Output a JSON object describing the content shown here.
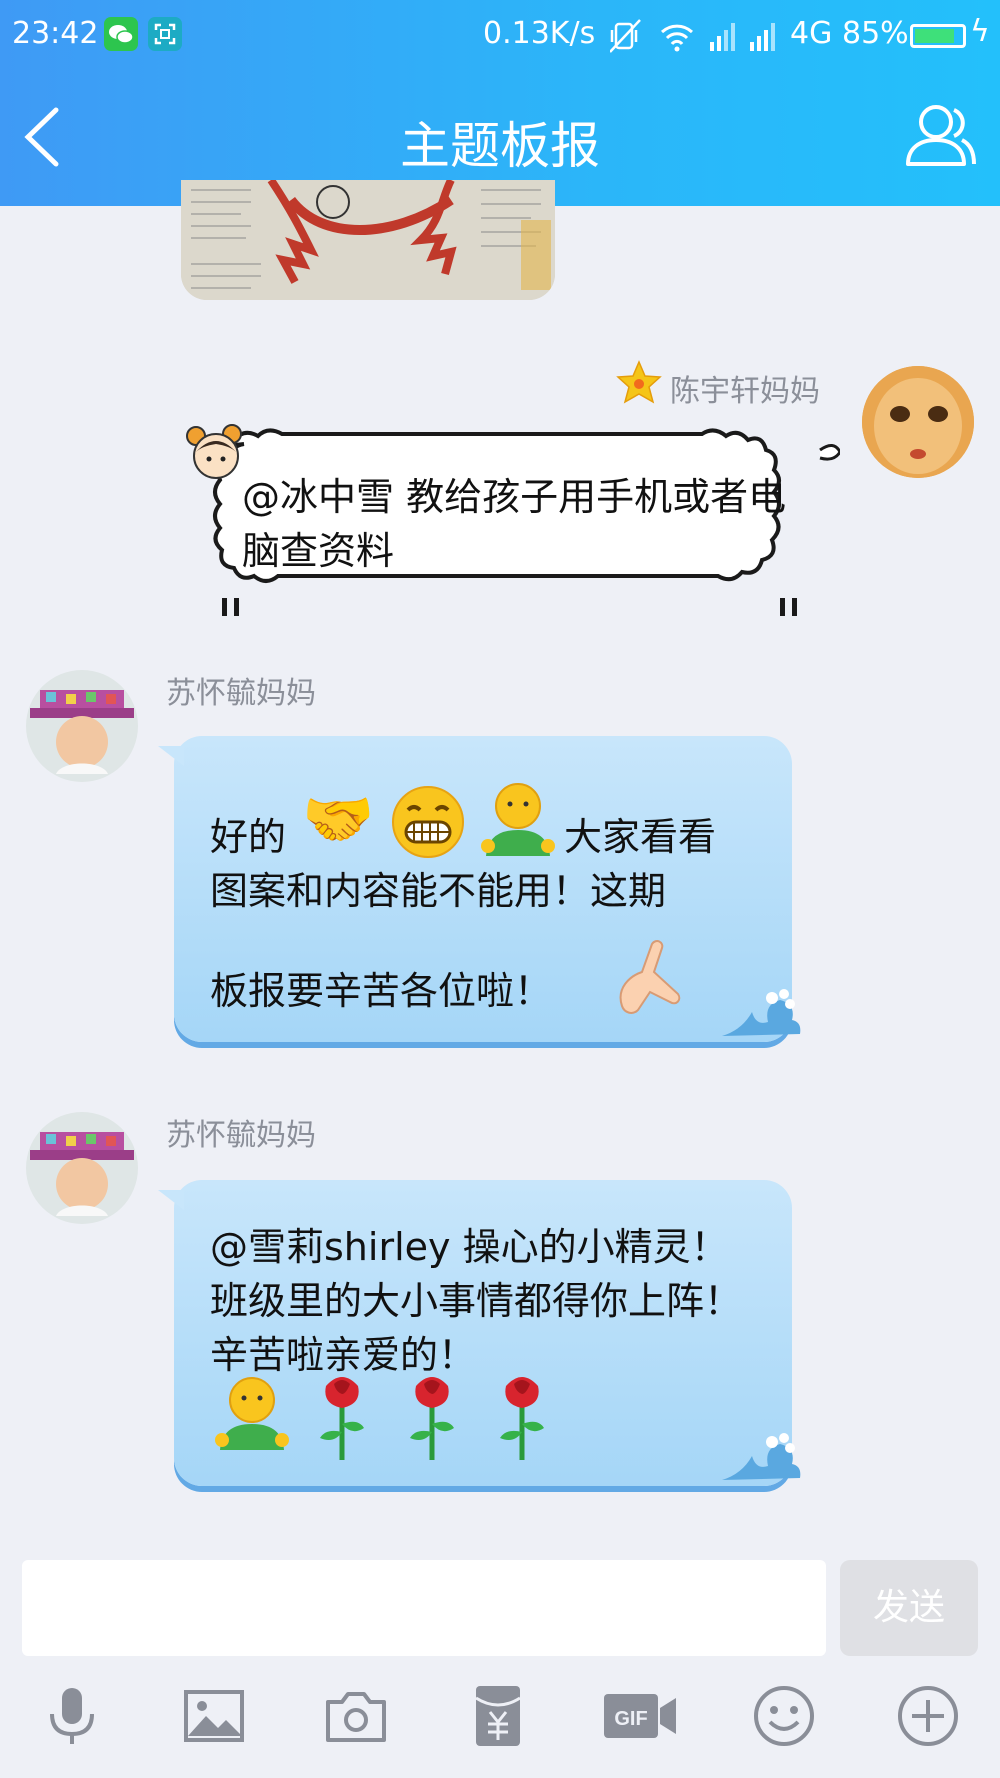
{
  "status_bar": {
    "time": "23:42",
    "speed": "0.13K/s",
    "network": "4G",
    "battery_percent": "85%",
    "battery_level": 0.85,
    "icons": [
      "wechat-app-icon",
      "scan-app-icon",
      "vibrate-icon",
      "wifi-icon",
      "signal-icon",
      "signal-icon",
      "battery-icon",
      "charging-icon"
    ]
  },
  "nav": {
    "title": "主题板报"
  },
  "messages": [
    {
      "sender": "陈宇轩妈妈",
      "side": "right",
      "text": "@冰中雪 教给孩子用手机或者电脑查资料"
    },
    {
      "sender": "苏怀毓妈妈",
      "side": "left",
      "text_line1": "好的",
      "text_line1b": "大家看看",
      "text_line2": "图案和内容能不能用！这期",
      "text_line3": "板报要辛苦各位啦！",
      "emojis": [
        "handshake",
        "grin",
        "person",
        "ok-hand"
      ]
    },
    {
      "sender": "苏怀毓妈妈",
      "side": "left",
      "text": "@雪莉shirley 操心的小精灵！班级里的大小事情都得你上阵！辛苦啦亲爱的！",
      "emojis": [
        "person",
        "rose",
        "rose",
        "rose"
      ]
    }
  ],
  "input": {
    "send_label": "发送"
  },
  "toolbar": [
    "microphone-icon",
    "image-icon",
    "camera-icon",
    "red-packet-icon",
    "gif-icon",
    "emoji-icon",
    "plus-icon"
  ],
  "colors": {
    "header_start": "#3f9af5",
    "header_end": "#23c0fb",
    "bubble": "#b6ddf8",
    "background": "#eef0f6"
  }
}
